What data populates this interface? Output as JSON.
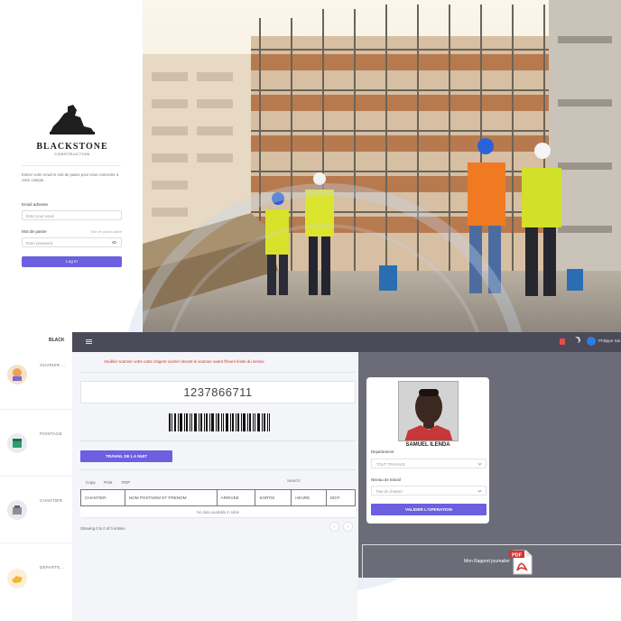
{
  "login": {
    "brand_name": "BLACKSTONE",
    "brand_sub": "CONSTRUCTION",
    "intro": "Entrez votre email et mot de passe pour vous connecter à votre compte.",
    "email_label": "Email adresse",
    "email_placeholder": "Enter your email",
    "password_label": "Mot de passe",
    "forgot_link": "Mot de passe oublié",
    "password_placeholder": "Enter password",
    "login_button": "Log In"
  },
  "sidebar": {
    "logo": "BLACK",
    "items": [
      {
        "label": "OUVRIER ...",
        "icon": "worker-icon"
      },
      {
        "label": "POINTAGE",
        "icon": "calendar-icon"
      },
      {
        "label": "CHANTIER",
        "icon": "crane-icon"
      },
      {
        "label": "DEPARTE...",
        "icon": "hand-icon"
      }
    ]
  },
  "topbar": {
    "user_name": "Philippe Sai",
    "icons": [
      "menu-icon",
      "flag-icon",
      "moon-icon",
      "user-avatar"
    ]
  },
  "main": {
    "alert": "Veuillez scanner votre carte d'agent ouvrier devant le scanner avant l'heure limite du sessio.",
    "scan_value": "1237866711",
    "night_button": "TRAVAIL DE LA NUIT",
    "export_buttons": [
      "Copy",
      "Print",
      "PDF"
    ],
    "search_label": "Search:",
    "table": {
      "headers": [
        "CHANTIER",
        "NOM POSTNOM ET PRENOM",
        "ARRIVEE",
        "SORTIE",
        "HEURE",
        "EDIT"
      ],
      "empty_message": "No data available in table"
    },
    "showing": "Showing 0 to 0 of 0 entries",
    "pagination": [
      "‹",
      "›"
    ]
  },
  "card": {
    "name": "SAMUEL ILENDA",
    "department_label": "Departement",
    "department_value": "TOUT TRAVAUX",
    "level_label": "Niveau de travail",
    "level_value": "Pas de chantier",
    "validate_button": "VALIDER L'OPERATION"
  },
  "report": {
    "label": "Mon Rapport journalier",
    "icon": "pdf-icon",
    "icon_text": "PDF"
  },
  "colors": {
    "accent": "#6c5fe0",
    "topbar": "#4a4a59",
    "panel": "#6c6c78",
    "alert": "#c0392b"
  }
}
